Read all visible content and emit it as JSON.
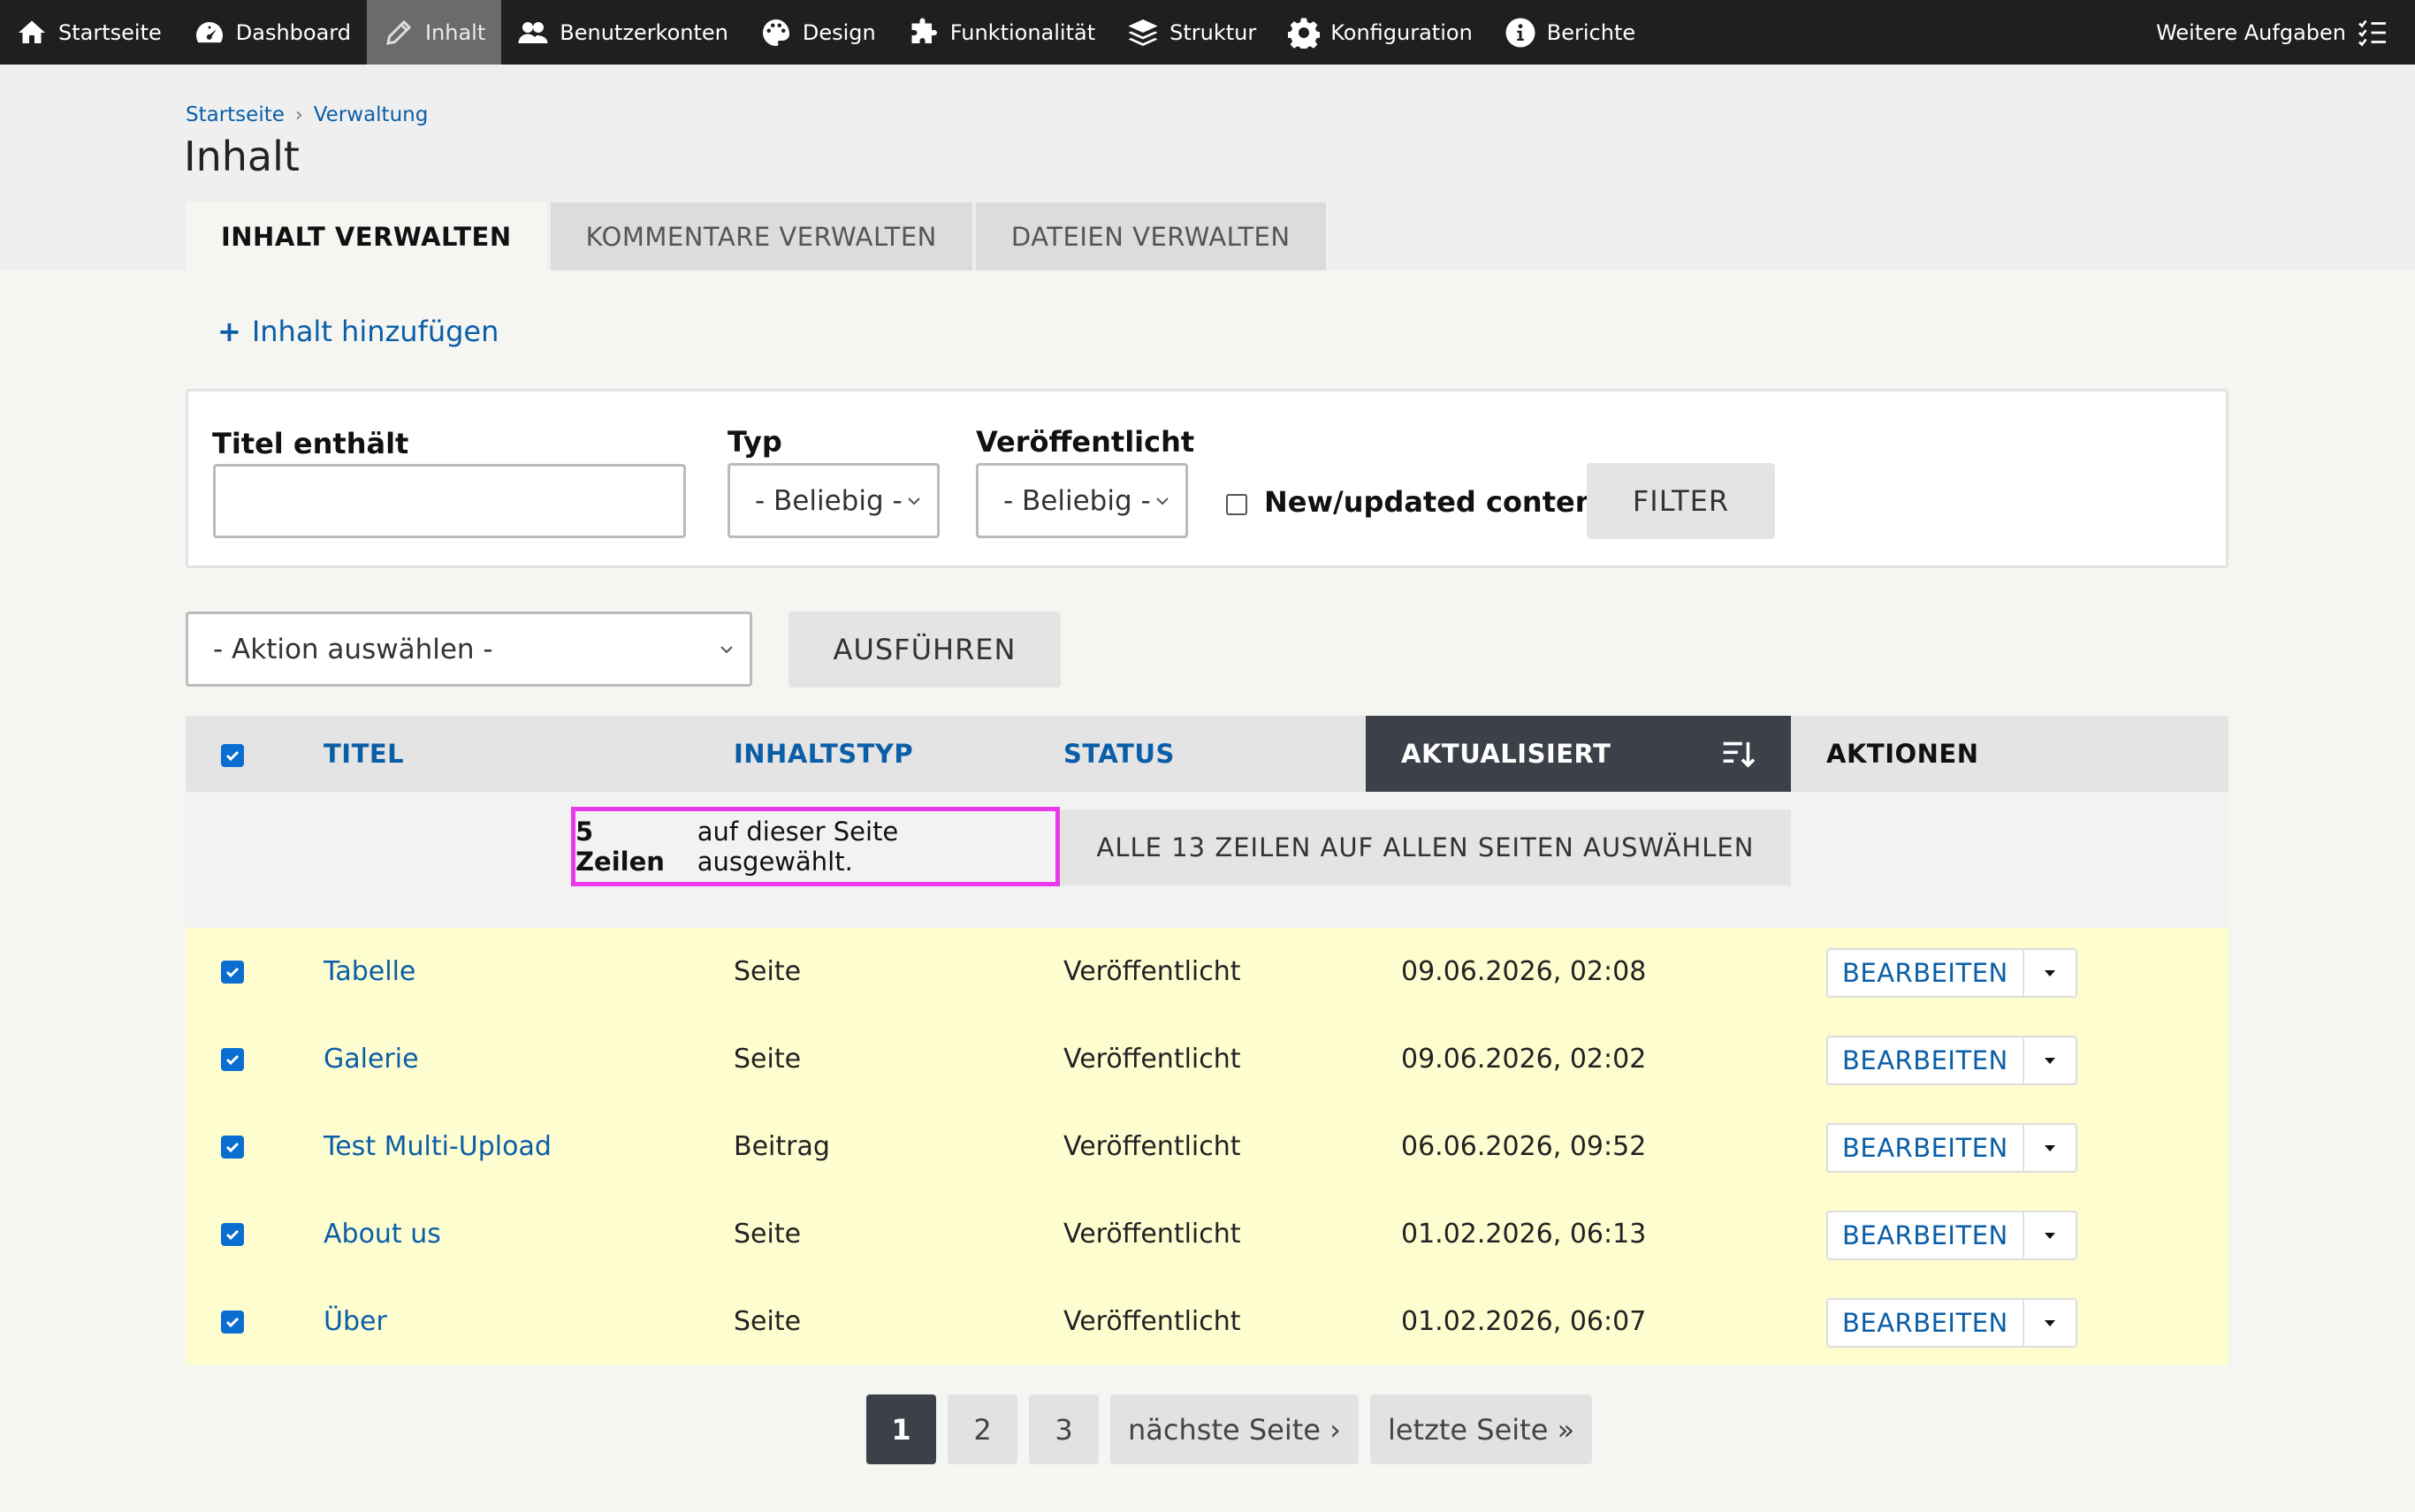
{
  "toolbar": {
    "items": [
      {
        "label": "Startseite",
        "icon": "home-icon"
      },
      {
        "label": "Dashboard",
        "icon": "dashboard-icon"
      },
      {
        "label": "Inhalt",
        "icon": "pencil-icon",
        "active": true
      },
      {
        "label": "Benutzerkonten",
        "icon": "users-icon"
      },
      {
        "label": "Design",
        "icon": "palette-icon"
      },
      {
        "label": "Funktionalität",
        "icon": "puzzle-icon"
      },
      {
        "label": "Struktur",
        "icon": "layers-icon"
      },
      {
        "label": "Konfiguration",
        "icon": "gear-icon"
      },
      {
        "label": "Berichte",
        "icon": "info-icon"
      }
    ],
    "more_tasks": "Weitere Aufgaben"
  },
  "breadcrumb": {
    "home": "Startseite",
    "separator": "›",
    "admin": "Verwaltung"
  },
  "page_title": "Inhalt",
  "tabs": [
    {
      "label": "INHALT VERWALTEN",
      "active": true
    },
    {
      "label": "KOMMENTARE VERWALTEN"
    },
    {
      "label": "DATEIEN VERWALTEN"
    }
  ],
  "add_content": {
    "plus": "+",
    "label": "Inhalt hinzufügen"
  },
  "filter": {
    "title_label": "Titel enthält",
    "title_value": "",
    "type_label": "Typ",
    "type_value": "- Beliebig -",
    "published_label": "Veröffentlicht",
    "published_value": "- Beliebig -",
    "new_content_label": "New/updated content",
    "filter_button": "FILTER"
  },
  "bulk": {
    "action_value": "- Aktion auswählen -",
    "apply_button": "AUSFÜHREN"
  },
  "table": {
    "headers": {
      "title": "TITEL",
      "type": "INHALTSTYP",
      "status": "STATUS",
      "updated": "AKTUALISIERT",
      "actions": "AKTIONEN"
    },
    "selection": {
      "count": "5 Zeilen",
      "text": "auf dieser Seite ausgewählt.",
      "select_all": "ALLE 13 ZEILEN AUF ALLEN SEITEN AUSWÄHLEN"
    },
    "rows": [
      {
        "title": "Tabelle",
        "type": "Seite",
        "status": "Veröffentlicht",
        "updated": "09.06.2026, 02:08",
        "action": "BEARBEITEN"
      },
      {
        "title": "Galerie",
        "type": "Seite",
        "status": "Veröffentlicht",
        "updated": "09.06.2026, 02:02",
        "action": "BEARBEITEN"
      },
      {
        "title": "Test Multi-Upload",
        "type": "Beitrag",
        "status": "Veröffentlicht",
        "updated": "06.06.2026, 09:52",
        "action": "BEARBEITEN"
      },
      {
        "title": "About us",
        "type": "Seite",
        "status": "Veröffentlicht",
        "updated": "01.02.2026, 06:13",
        "action": "BEARBEITEN"
      },
      {
        "title": "Über",
        "type": "Seite",
        "status": "Veröffentlicht",
        "updated": "01.02.2026, 06:07",
        "action": "BEARBEITEN"
      }
    ]
  },
  "pager": {
    "pages": [
      "1",
      "2",
      "3"
    ],
    "next": "nächste Seite ›",
    "last": "letzte Seite »"
  },
  "colors": {
    "link": "#0a5ea8",
    "selected_row": "#fefdd0",
    "highlight_border": "#ea39ea",
    "sorted_header": "#3c4149",
    "toolbar": "#1f1f1f"
  }
}
